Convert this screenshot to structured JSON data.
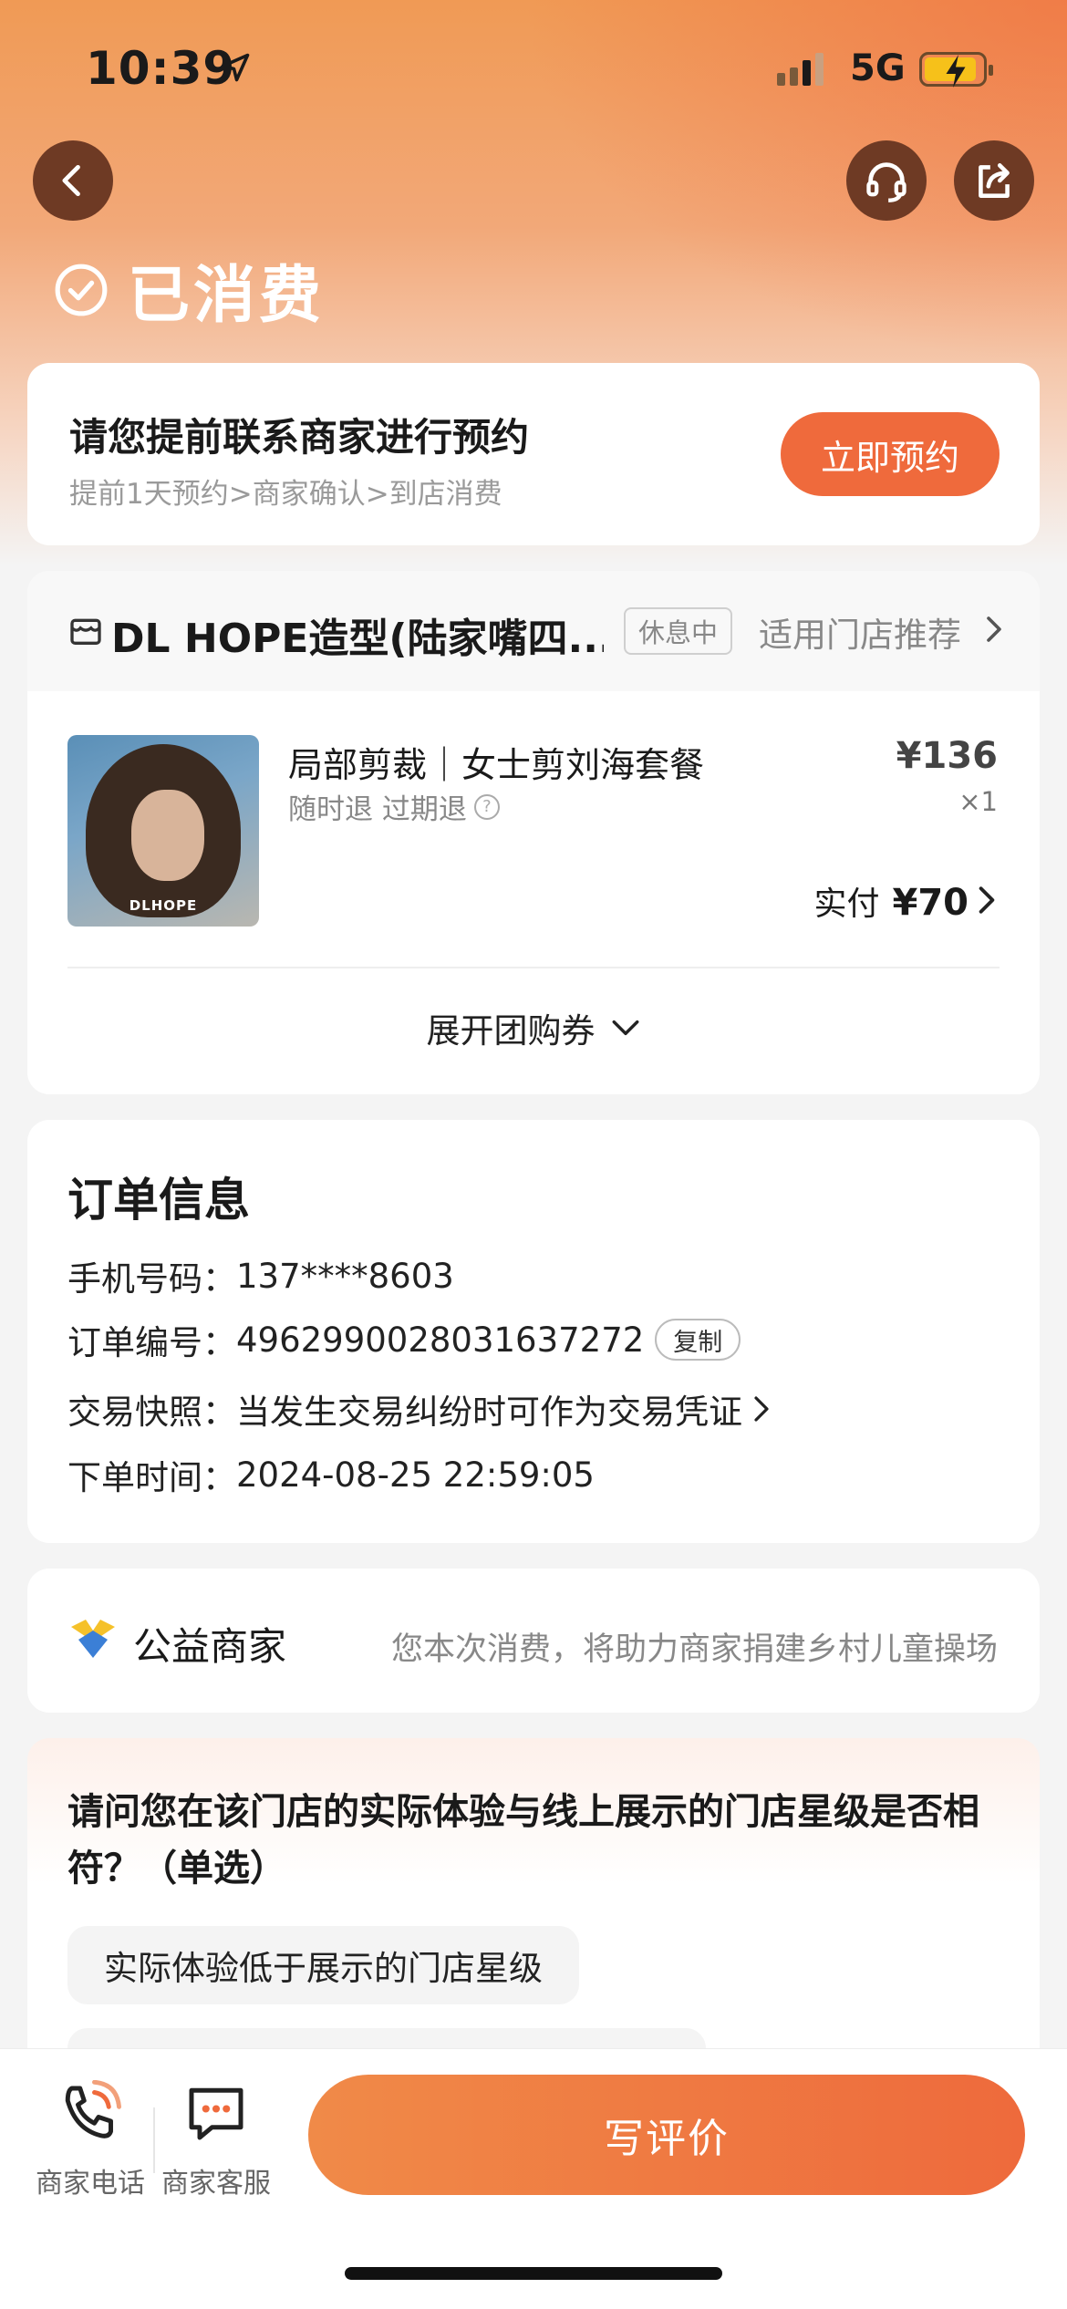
{
  "status_bar": {
    "time": "10:39",
    "network": "5G"
  },
  "header": {
    "status_title": "已消费"
  },
  "booking": {
    "title": "请您提前联系商家进行预约",
    "steps": "提前1天预约>商家确认>到店消费",
    "button": "立即预约"
  },
  "shop": {
    "name": "DL HOPE造型(陆家嘴四...",
    "badge": "休息中",
    "recommend": "适用门店推荐",
    "product": {
      "image_logo": "DLHOPE",
      "name": "局部剪裁｜女士剪刘海套餐",
      "tags": "随时退 过期退",
      "price": "¥136",
      "quantity": "×1",
      "paid_label": "实付",
      "paid_amount": "¥70"
    },
    "expand": "展开团购券"
  },
  "order": {
    "title": "订单信息",
    "phone_label": "手机号码：",
    "phone": "137****8603",
    "number_label": "订单编号：",
    "number": "4962990028031637272",
    "copy": "复制",
    "snapshot_label": "交易快照：",
    "snapshot": "当发生交易纠纷时可作为交易凭证",
    "time_label": "下单时间：",
    "time": "2024-08-25 22:59:05"
  },
  "charity": {
    "label": "公益商家",
    "desc": "您本次消费，将助力商家捐建乡村儿童操场"
  },
  "survey": {
    "question": "请问您在该门店的实际体验与线上展示的门店星级是否相符？（单选）",
    "options": [
      "实际体验低于展示的门店星级"
    ]
  },
  "bottom_bar": {
    "phone": "商家电话",
    "service": "商家客服",
    "review": "写评价"
  },
  "colors": {
    "accent": "#ef6a3c",
    "header_gradient_start": "#f09a55",
    "dark_button": "#6e3a24"
  }
}
